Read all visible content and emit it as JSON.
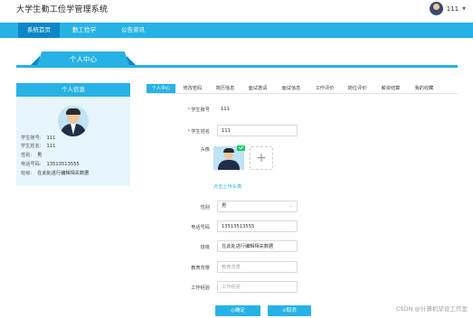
{
  "header": {
    "app_title": "大学生勤工俭学管理系统",
    "username": "111"
  },
  "nav": {
    "items": [
      {
        "label": "系统首页",
        "active": true
      },
      {
        "label": "勤工俭学",
        "active": false
      },
      {
        "label": "公告资讯",
        "active": false
      }
    ]
  },
  "banner": {
    "title": "个人中心"
  },
  "info_card": {
    "title": "个人信息",
    "fields": [
      {
        "label": "学生账号:",
        "value": "111"
      },
      {
        "label": "学生姓名:",
        "value": "111"
      },
      {
        "label": "性别:",
        "value": "男"
      },
      {
        "label": "电话号码:",
        "value": "13513513555"
      },
      {
        "label": "班级:",
        "value": "在此处进行编辑相关数据"
      }
    ]
  },
  "tabs": [
    {
      "label": "个人中心",
      "active": true
    },
    {
      "label": "修改密码",
      "active": false
    },
    {
      "label": "简历信息",
      "active": false
    },
    {
      "label": "面试邀请",
      "active": false
    },
    {
      "label": "面试信息",
      "active": false
    },
    {
      "label": "工作评价",
      "active": false
    },
    {
      "label": "岗位评价",
      "active": false
    },
    {
      "label": "薪资结算",
      "active": false
    },
    {
      "label": "我的收藏",
      "active": false
    }
  ],
  "form": {
    "account": {
      "label": "学生账号",
      "value": "111"
    },
    "name": {
      "label": "学生姓名",
      "value": "111"
    },
    "avatar": {
      "label": "头像",
      "upload_hint": "点击上传头像",
      "add_symbol": "+"
    },
    "gender": {
      "label": "性别",
      "value": "男"
    },
    "phone": {
      "label": "电话号码",
      "value": "13513513555"
    },
    "class": {
      "label": "班级",
      "value": "在此处进行编辑相关数据"
    },
    "education": {
      "label": "教育背景",
      "placeholder": "教育背景"
    },
    "work": {
      "label": "工作经验",
      "placeholder": "工作经验"
    },
    "confirm_label": "◎确定",
    "cancel_label": "⊙取消"
  },
  "watermark": "CSDN @计算机毕设工作室",
  "colors": {
    "accent": "#27b2e5",
    "accent_dark": "#0b86c7",
    "card_bg": "#e7f5fc"
  }
}
